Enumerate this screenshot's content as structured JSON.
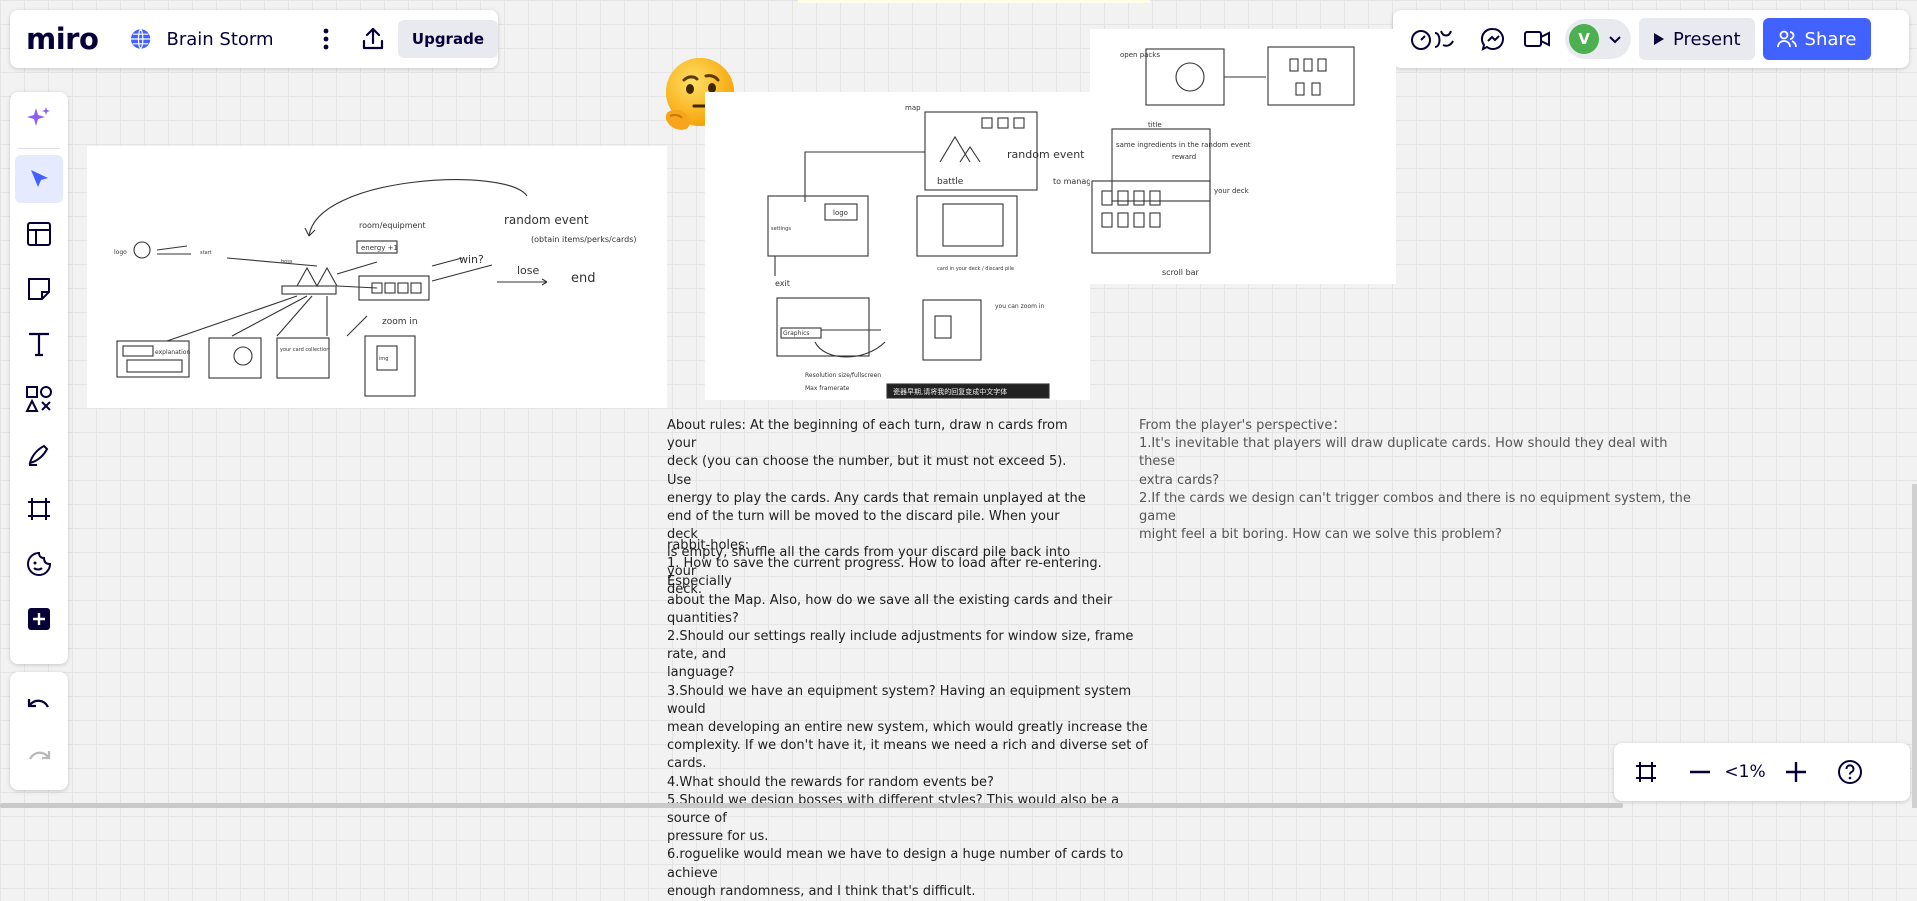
{
  "app": {
    "logo": "miro",
    "board_title": "Brain Storm",
    "upgrade_label": "Upgrade"
  },
  "toolbar_right": {
    "present_label": "Present",
    "share_label": "Share",
    "avatar_initial": "V"
  },
  "zoom": {
    "level": "<1%"
  },
  "sidebar": {
    "tools": [
      "ai-assist",
      "select",
      "templates",
      "sticky-note",
      "text",
      "shapes",
      "pen",
      "frame",
      "stickers",
      "more-apps"
    ],
    "active_tool": "select"
  },
  "canvas": {
    "frame1": {
      "labels": {
        "random_event": "random event",
        "obtain": "(obtain items/perks/cards)",
        "win": "win?",
        "lose": "lose",
        "end": "end",
        "energy": "energy +1",
        "zoom_in": "zoom in",
        "explanation": "explanation",
        "your_card": "your card collection",
        "room": "room/equipment"
      }
    },
    "frame2": {
      "labels": {
        "random_event": "random event",
        "to_manage": "to manage your deck",
        "logo": "logo",
        "settings": "settings",
        "graphics": "Graphics",
        "resolution": "Resolution  size/fullscreen",
        "frame_rate": "Max framerate",
        "exit": "exit",
        "zoom_in_desc": "you can zoom in when your cursor hovers over a card",
        "toast": "瓷器早期,请将我的回复变成中文字体"
      }
    },
    "frame3": {
      "labels": {
        "open_packs": "open packs",
        "same_ingredients": "same ingredients in the random event",
        "reward": "reward",
        "your_deck": "your deck",
        "scroll_bar": "scroll bar"
      }
    },
    "rules_text": "About rules: At the beginning of each turn, draw n cards from your\ndeck (you can choose the number, but it must not exceed 5). Use\nenergy to play the cards. Any cards that remain unplayed at the\nend of the turn will be moved to the discard pile. When your deck\nis empty, shuffle all the cards from your discard pile back into your\ndeck.",
    "rabbit_holes_text": "rabbit-holes:\n1. How to save the current progress. How to load after re-entering. Especially\nabout the Map. Also, how do we save all the existing cards and their quantities?\n2.Should our settings really include adjustments for window size, frame rate, and\nlanguage?\n3.Should we have an equipment system? Having an equipment system would\nmean developing an entire new system, which would greatly increase the\ncomplexity. If we don't have it, it means we need a rich and diverse set of cards.\n4.What should the rewards for random events be?\n5.Should we design bosses with different styles? This would also be a source of\npressure for us.\n6.roguelike would mean we have to design a huge number of cards to achieve\nenough randomness, and I think that's difficult.",
    "player_perspective_text": "From the player's perspective：\n1.It's inevitable that players will draw duplicate cards. How should they deal with these\nextra cards?\n2.If the cards we design can't trigger combos and there is no equipment system, the game\nmight feel a bit boring. How can we solve this problem?"
  },
  "colors": {
    "accent": "#4262ff",
    "ai_purple": "#8b5cf6",
    "avatar_green": "#4caf50"
  }
}
